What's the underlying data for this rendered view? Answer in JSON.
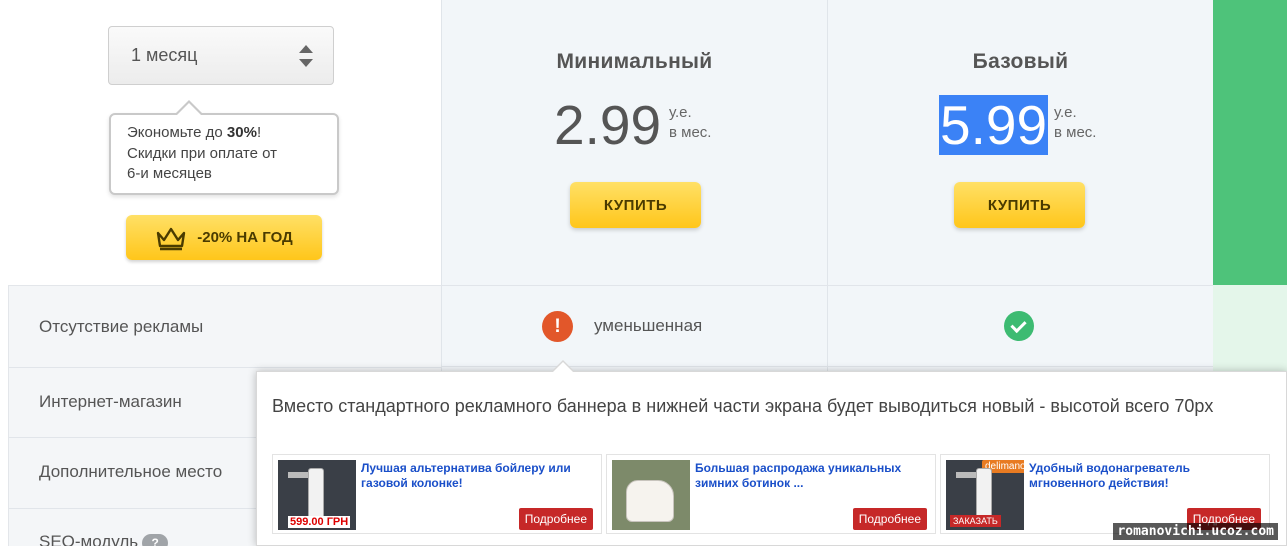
{
  "period_select": {
    "value": "1 месяц"
  },
  "discount_tooltip": {
    "line1_prefix": "Экономьте до ",
    "line1_bold": "30%",
    "line1_suffix": "!",
    "line2": "Скидки при оплате от",
    "line3": "6-и месяцев"
  },
  "year_button": {
    "label": "-20% НА ГОД",
    "icon": "crown-icon"
  },
  "plans": [
    {
      "title": "Минимальный",
      "price": "2.99",
      "unit_line1": "у.е.",
      "unit_line2": "в мес.",
      "buy_label": "КУПИТЬ"
    },
    {
      "title": "Базовый",
      "price": "5.99",
      "unit_line1": "у.е.",
      "unit_line2": "в мес.",
      "buy_label": "КУПИТЬ"
    }
  ],
  "features": [
    {
      "label": "Отсутствие рекламы"
    },
    {
      "label": "Интернет-магазин"
    },
    {
      "label": "Дополнительное место"
    },
    {
      "label": "SEO-модуль",
      "badge": "?"
    }
  ],
  "ads_row": {
    "minimal_status": "уменьшенная",
    "minimal_icon": "exclamation-icon",
    "base_icon": "checkmark-icon"
  },
  "popup": {
    "text": "Вместо стандартного рекламного баннера в нижней части экрана будет выводиться новый - высотой всего 70px",
    "cards": [
      {
        "title": "Лучшая альтернатива бойлеру или газовой колонке!",
        "price": "599.00 ГРН",
        "more": "Подробнее"
      },
      {
        "title": "Большая распродажа уникальных зимних ботинок ...",
        "more": "Подробнее"
      },
      {
        "title": "Удобный водонагреватель мгновенного действия!",
        "brand": "delimano",
        "order": "ЗАКАЗАТЬ",
        "more": "Подробнее"
      }
    ]
  },
  "watermark": "romanovichi.ucoz.com",
  "colors": {
    "accent_yellow": "#ffc61a",
    "green": "#4ec37a",
    "warning": "#e2572a",
    "check": "#3dbb72",
    "selection": "#3b82f6"
  }
}
